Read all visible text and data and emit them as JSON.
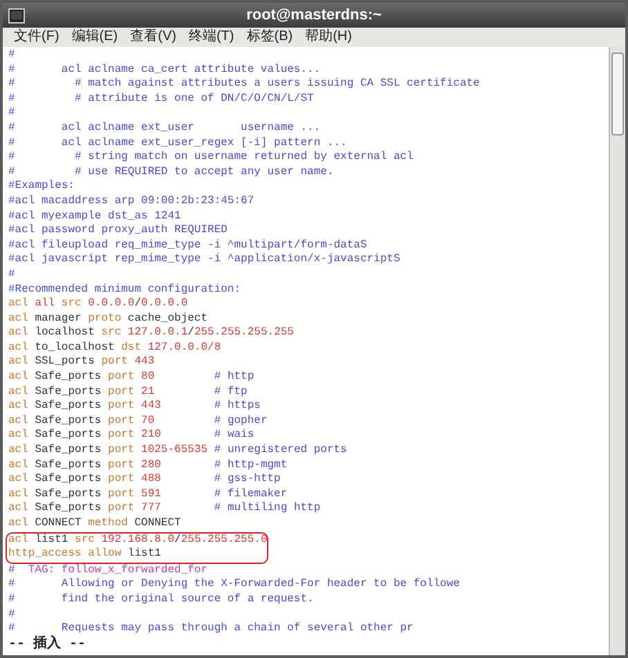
{
  "window": {
    "title": "root@masterdns:~"
  },
  "menu": [
    "文件(F)",
    "编辑(E)",
    "查看(V)",
    "终端(T)",
    "标签(B)",
    "帮助(H)"
  ],
  "lines": [
    {
      "boxed": false,
      "segments": [
        {
          "kind": "comment",
          "text": "#"
        }
      ]
    },
    {
      "boxed": false,
      "segments": [
        {
          "kind": "comment",
          "text": "#       acl aclname ca_cert attribute values..."
        }
      ]
    },
    {
      "boxed": false,
      "segments": [
        {
          "kind": "comment",
          "text": "#         # match against attributes a users issuing CA SSL certificate"
        }
      ]
    },
    {
      "boxed": false,
      "segments": [
        {
          "kind": "comment",
          "text": "#         # attribute is one of DN/C/O/CN/L/ST"
        }
      ]
    },
    {
      "boxed": false,
      "segments": [
        {
          "kind": "comment",
          "text": "#"
        }
      ]
    },
    {
      "boxed": false,
      "segments": [
        {
          "kind": "comment",
          "text": "#       acl aclname ext_user       username ..."
        }
      ]
    },
    {
      "boxed": false,
      "segments": [
        {
          "kind": "comment",
          "text": "#       acl aclname ext_user_regex [-i] pattern ..."
        }
      ]
    },
    {
      "boxed": false,
      "segments": [
        {
          "kind": "comment",
          "text": "#         # string match on username returned by external acl"
        }
      ]
    },
    {
      "boxed": false,
      "segments": [
        {
          "kind": "comment",
          "text": "#         # use REQUIRED to accept any user name."
        }
      ]
    },
    {
      "boxed": false,
      "segments": [
        {
          "kind": "comment",
          "text": "#Examples:"
        }
      ]
    },
    {
      "boxed": false,
      "segments": [
        {
          "kind": "comment",
          "text": "#acl macaddress arp 09:00:2b:23:45:67"
        }
      ]
    },
    {
      "boxed": false,
      "segments": [
        {
          "kind": "comment",
          "text": "#acl myexample dst_as 1241"
        }
      ]
    },
    {
      "boxed": false,
      "segments": [
        {
          "kind": "comment",
          "text": "#acl password proxy_auth REQUIRED"
        }
      ]
    },
    {
      "boxed": false,
      "segments": [
        {
          "kind": "comment",
          "text": "#acl fileupload req_mime_type -i ^multipart/form-dataS"
        }
      ]
    },
    {
      "boxed": false,
      "segments": [
        {
          "kind": "comment",
          "text": "#acl javascript rep_mime_type -i ^application/x-javascriptS"
        }
      ]
    },
    {
      "boxed": false,
      "segments": [
        {
          "kind": "comment",
          "text": "#"
        }
      ]
    },
    {
      "boxed": false,
      "segments": [
        {
          "kind": "comment",
          "text": "#Recommended minimum configuration:"
        }
      ]
    },
    {
      "boxed": false,
      "segments": [
        {
          "kind": "keyword",
          "text": "acl "
        },
        {
          "kind": "value",
          "text": "all "
        },
        {
          "kind": "keyword",
          "text": "src "
        },
        {
          "kind": "value",
          "text": "0.0.0.0"
        },
        {
          "kind": "plain",
          "text": "/"
        },
        {
          "kind": "value",
          "text": "0.0.0.0"
        }
      ]
    },
    {
      "boxed": false,
      "segments": [
        {
          "kind": "keyword",
          "text": "acl "
        },
        {
          "kind": "plain",
          "text": "manager "
        },
        {
          "kind": "keyword",
          "text": "proto "
        },
        {
          "kind": "plain",
          "text": "cache_object"
        }
      ]
    },
    {
      "boxed": false,
      "segments": [
        {
          "kind": "keyword",
          "text": "acl "
        },
        {
          "kind": "plain",
          "text": "localhost "
        },
        {
          "kind": "keyword",
          "text": "src "
        },
        {
          "kind": "value",
          "text": "127.0.0.1"
        },
        {
          "kind": "plain",
          "text": "/"
        },
        {
          "kind": "value",
          "text": "255.255.255.255"
        }
      ]
    },
    {
      "boxed": false,
      "segments": [
        {
          "kind": "keyword",
          "text": "acl "
        },
        {
          "kind": "plain",
          "text": "to_localhost "
        },
        {
          "kind": "keyword",
          "text": "dst "
        },
        {
          "kind": "value",
          "text": "127.0.0.0/8"
        }
      ]
    },
    {
      "boxed": false,
      "segments": [
        {
          "kind": "keyword",
          "text": "acl "
        },
        {
          "kind": "plain",
          "text": "SSL_ports "
        },
        {
          "kind": "keyword",
          "text": "port "
        },
        {
          "kind": "value",
          "text": "443"
        }
      ]
    },
    {
      "boxed": false,
      "segments": [
        {
          "kind": "keyword",
          "text": "acl "
        },
        {
          "kind": "plain",
          "text": "Safe_ports "
        },
        {
          "kind": "keyword",
          "text": "port "
        },
        {
          "kind": "value",
          "text": "80         "
        },
        {
          "kind": "comment",
          "text": "# http"
        }
      ]
    },
    {
      "boxed": false,
      "segments": [
        {
          "kind": "keyword",
          "text": "acl "
        },
        {
          "kind": "plain",
          "text": "Safe_ports "
        },
        {
          "kind": "keyword",
          "text": "port "
        },
        {
          "kind": "value",
          "text": "21         "
        },
        {
          "kind": "comment",
          "text": "# ftp"
        }
      ]
    },
    {
      "boxed": false,
      "segments": [
        {
          "kind": "keyword",
          "text": "acl "
        },
        {
          "kind": "plain",
          "text": "Safe_ports "
        },
        {
          "kind": "keyword",
          "text": "port "
        },
        {
          "kind": "value",
          "text": "443        "
        },
        {
          "kind": "comment",
          "text": "# https"
        }
      ]
    },
    {
      "boxed": false,
      "segments": [
        {
          "kind": "keyword",
          "text": "acl "
        },
        {
          "kind": "plain",
          "text": "Safe_ports "
        },
        {
          "kind": "keyword",
          "text": "port "
        },
        {
          "kind": "value",
          "text": "70         "
        },
        {
          "kind": "comment",
          "text": "# gopher"
        }
      ]
    },
    {
      "boxed": false,
      "segments": [
        {
          "kind": "keyword",
          "text": "acl "
        },
        {
          "kind": "plain",
          "text": "Safe_ports "
        },
        {
          "kind": "keyword",
          "text": "port "
        },
        {
          "kind": "value",
          "text": "210        "
        },
        {
          "kind": "comment",
          "text": "# wais"
        }
      ]
    },
    {
      "boxed": false,
      "segments": [
        {
          "kind": "keyword",
          "text": "acl "
        },
        {
          "kind": "plain",
          "text": "Safe_ports "
        },
        {
          "kind": "keyword",
          "text": "port "
        },
        {
          "kind": "value",
          "text": "1025-65535 "
        },
        {
          "kind": "comment",
          "text": "# unregistered ports"
        }
      ]
    },
    {
      "boxed": false,
      "segments": [
        {
          "kind": "keyword",
          "text": "acl "
        },
        {
          "kind": "plain",
          "text": "Safe_ports "
        },
        {
          "kind": "keyword",
          "text": "port "
        },
        {
          "kind": "value",
          "text": "280        "
        },
        {
          "kind": "comment",
          "text": "# http-mgmt"
        }
      ]
    },
    {
      "boxed": false,
      "segments": [
        {
          "kind": "keyword",
          "text": "acl "
        },
        {
          "kind": "plain",
          "text": "Safe_ports "
        },
        {
          "kind": "keyword",
          "text": "port "
        },
        {
          "kind": "value",
          "text": "488        "
        },
        {
          "kind": "comment",
          "text": "# gss-http"
        }
      ]
    },
    {
      "boxed": false,
      "segments": [
        {
          "kind": "keyword",
          "text": "acl "
        },
        {
          "kind": "plain",
          "text": "Safe_ports "
        },
        {
          "kind": "keyword",
          "text": "port "
        },
        {
          "kind": "value",
          "text": "591        "
        },
        {
          "kind": "comment",
          "text": "# filemaker"
        }
      ]
    },
    {
      "boxed": false,
      "segments": [
        {
          "kind": "keyword",
          "text": "acl "
        },
        {
          "kind": "plain",
          "text": "Safe_ports "
        },
        {
          "kind": "keyword",
          "text": "port "
        },
        {
          "kind": "value",
          "text": "777        "
        },
        {
          "kind": "comment",
          "text": "# multiling http"
        }
      ]
    },
    {
      "boxed": false,
      "segments": [
        {
          "kind": "keyword",
          "text": "acl "
        },
        {
          "kind": "plain",
          "text": "CONNECT "
        },
        {
          "kind": "keyword",
          "text": "method "
        },
        {
          "kind": "plain",
          "text": "CONNECT"
        }
      ]
    },
    {
      "boxed": true,
      "segments": [
        {
          "kind": "keyword",
          "text": "acl "
        },
        {
          "kind": "plain",
          "text": "list1 "
        },
        {
          "kind": "keyword",
          "text": "src "
        },
        {
          "kind": "value",
          "text": "192.168.8.0"
        },
        {
          "kind": "plain",
          "text": "/"
        },
        {
          "kind": "value",
          "text": "255.255.255.0"
        }
      ]
    },
    {
      "boxed": true,
      "segments": [
        {
          "kind": "keyword",
          "text": "http_access allow "
        },
        {
          "kind": "plain",
          "text": "list1"
        }
      ]
    },
    {
      "boxed": false,
      "segments": [
        {
          "kind": "comment",
          "text": "#  "
        },
        {
          "kind": "tag",
          "text": "TAG: follow_x_forwarded_for"
        }
      ]
    },
    {
      "boxed": false,
      "segments": [
        {
          "kind": "comment",
          "text": "#       Allowing or Denying the X-Forwarded-For header to be followe"
        }
      ]
    },
    {
      "boxed": false,
      "segments": [
        {
          "kind": "comment",
          "text": "#       find the original source of a request."
        }
      ]
    },
    {
      "boxed": false,
      "segments": [
        {
          "kind": "comment",
          "text": "#"
        }
      ]
    },
    {
      "boxed": false,
      "segments": [
        {
          "kind": "comment",
          "text": "#       Requests may pass through a chain of several other pr"
        }
      ]
    }
  ],
  "status_line": "-- 插入 --"
}
